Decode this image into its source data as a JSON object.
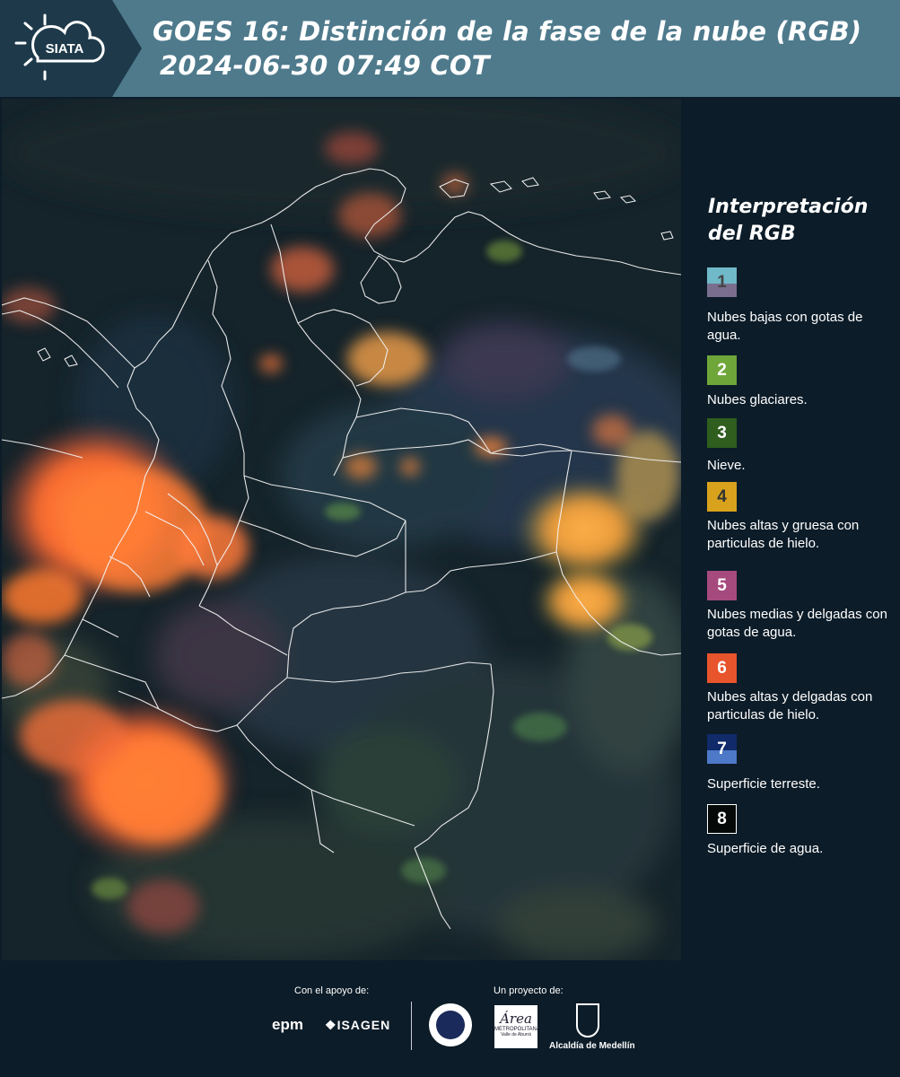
{
  "header": {
    "logo_text": "SIATA",
    "title_line1": "GOES 16: Distinción de la fase de la nube (RGB)",
    "title_line2": "2024-06-30 07:49 COT"
  },
  "legend": {
    "title": "Interpretación del RGB",
    "items": [
      {
        "number": "1",
        "label": "Nubes bajas con gotas de agua.",
        "color_top": "#6fb9c8",
        "color_bottom": "#7a6e8e"
      },
      {
        "number": "2",
        "label": "Nubes glaciares.",
        "color_top": "#6ea63a",
        "color_bottom": "#6ea63a"
      },
      {
        "number": "3",
        "label": "Nieve.",
        "color_top": "#2f5e1e",
        "color_bottom": "#2f5e1e"
      },
      {
        "number": "4",
        "label": "Nubes altas y gruesa con particulas de hielo.",
        "color_top": "#d8a21c",
        "color_bottom": "#d8a21c"
      },
      {
        "number": "5",
        "label": "Nubes medias y delgadas con gotas de agua.",
        "color_top": "#a64a7e",
        "color_bottom": "#a64a7e"
      },
      {
        "number": "6",
        "label": "Nubes altas y delgadas con particulas de hielo.",
        "color_top": "#e8542c",
        "color_bottom": "#e8542c"
      },
      {
        "number": "7",
        "label": "Superficie terreste.",
        "color_top": "#102a6a",
        "color_bottom": "#4e78c8"
      },
      {
        "number": "8",
        "label": "Superficie de agua.",
        "color_top": "#050a08",
        "color_bottom": "#050a08"
      }
    ]
  },
  "footer": {
    "support_label": "Con el apoyo de:",
    "project_label": "Un proyecto de:",
    "sponsor1": "epm",
    "sponsor2": "ISAGEN",
    "area_logo": "Área",
    "area_sub1": "METROPOLITANA",
    "area_sub2": "Valle de Aburrá",
    "alcaldia": "Alcaldía de Medellín"
  }
}
